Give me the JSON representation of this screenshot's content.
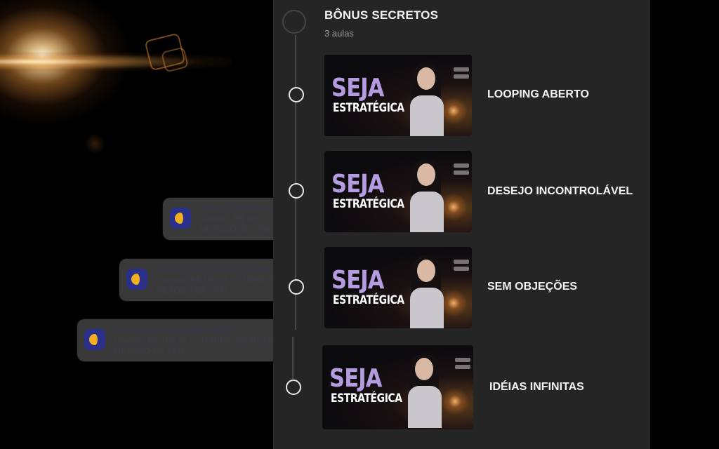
{
  "module": {
    "title": "BÔNUS SECRETOS",
    "subtitle": "3 aulas"
  },
  "lessons": [
    {
      "title": "LOOPING ABERTO",
      "thumb_line1": "SEJA",
      "thumb_line2": "ESTRATÉGICA"
    },
    {
      "title": "DESEJO INCONTROLÁVEL",
      "thumb_line1": "SEJA",
      "thumb_line2": "ESTRATÉGICA"
    },
    {
      "title": "SEM OBJEÇÕES",
      "thumb_line1": "SEJA",
      "thumb_line2": "ESTRATÉGICA"
    },
    {
      "title": "IDÉIAS INFINITAS",
      "thumb_line1": "SEJA",
      "thumb_line2": "ESTRATÉGICA"
    }
  ],
  "notifications": [
    {
      "title": "Venda Confirmada",
      "line1": "Ganhos: R$ 100,76",
      "line2": "METODO DE VEN"
    },
    {
      "title": "Venda Confirmada #5851286",
      "line1": "Ganhos: R$ 100,76 - STORIES",
      "line2": "METODO DE VEN"
    },
    {
      "title": "Venda Confirmada #58512864",
      "line1": "Ganhos: R$ 100,76 - STORIES SECRETO,",
      "line2": "METODO DE VEN"
    }
  ],
  "colors": {
    "panel_bg": "#252525",
    "accent_purple": "#b59ce0",
    "text_primary": "#f2f2f2",
    "text_muted": "#9a9a9a"
  }
}
